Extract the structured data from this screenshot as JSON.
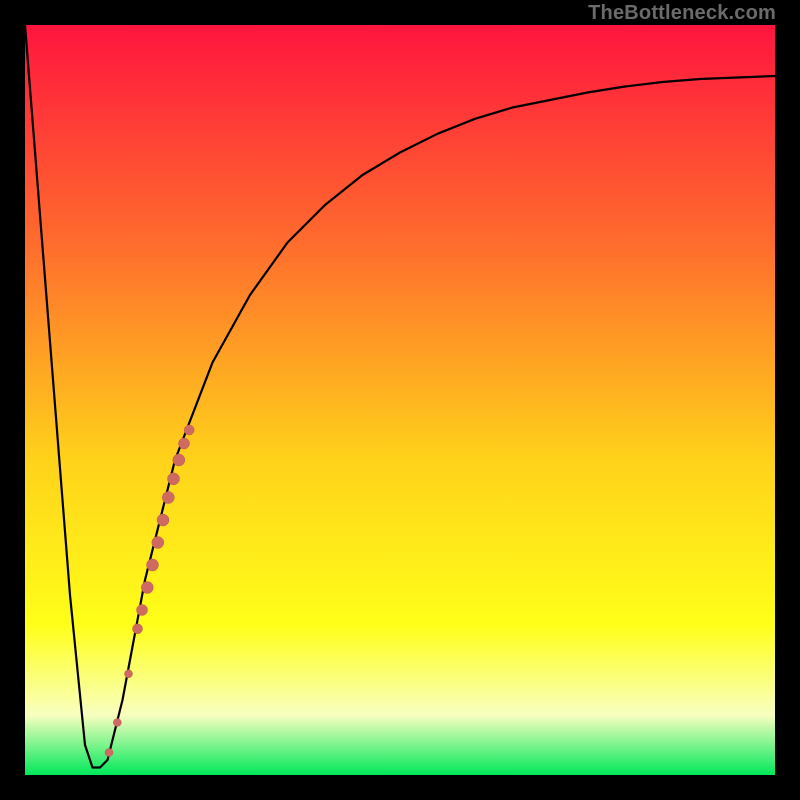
{
  "watermark": "TheBottleneck.com",
  "colors": {
    "gradient_top": "#ff153e",
    "gradient_mid_upper": "#ff6f2d",
    "gradient_mid": "#ffd21a",
    "gradient_mid_lower": "#ffff19",
    "gradient_pale": "#f8ffbf",
    "gradient_bottom": "#00e85a",
    "curve": "#000000",
    "marker_fill": "#cf6a62",
    "marker_stroke": "#bb5a52",
    "frame": "#000000"
  },
  "chart_data": {
    "type": "line",
    "title": "",
    "xlabel": "",
    "ylabel": "",
    "xlim": [
      0,
      100
    ],
    "ylim": [
      0,
      100
    ],
    "series": [
      {
        "name": "bottleneck-curve",
        "x": [
          0,
          3,
          6,
          8,
          9,
          10,
          11,
          13,
          16,
          20,
          25,
          30,
          35,
          40,
          45,
          50,
          55,
          60,
          65,
          70,
          75,
          80,
          85,
          90,
          95,
          100
        ],
        "y": [
          100,
          62,
          24,
          4,
          1,
          1,
          2,
          10,
          26,
          42,
          55,
          64,
          71,
          76,
          80,
          83,
          85.5,
          87.5,
          89,
          90,
          91,
          91.8,
          92.4,
          92.8,
          93,
          93.2
        ]
      }
    ],
    "markers": {
      "name": "highlighted-points",
      "points": [
        {
          "x": 11.2,
          "y": 3.0,
          "r": 4
        },
        {
          "x": 12.3,
          "y": 7.0,
          "r": 4
        },
        {
          "x": 13.8,
          "y": 13.5,
          "r": 4
        },
        {
          "x": 15.0,
          "y": 19.5,
          "r": 5
        },
        {
          "x": 15.6,
          "y": 22.0,
          "r": 5.5
        },
        {
          "x": 16.3,
          "y": 25.0,
          "r": 6
        },
        {
          "x": 17.0,
          "y": 28.0,
          "r": 6
        },
        {
          "x": 17.7,
          "y": 31.0,
          "r": 6
        },
        {
          "x": 18.4,
          "y": 34.0,
          "r": 6
        },
        {
          "x": 19.1,
          "y": 37.0,
          "r": 6
        },
        {
          "x": 19.8,
          "y": 39.5,
          "r": 6
        },
        {
          "x": 20.5,
          "y": 42.0,
          "r": 6
        },
        {
          "x": 21.2,
          "y": 44.2,
          "r": 5.5
        },
        {
          "x": 21.9,
          "y": 46.0,
          "r": 5
        }
      ]
    }
  }
}
